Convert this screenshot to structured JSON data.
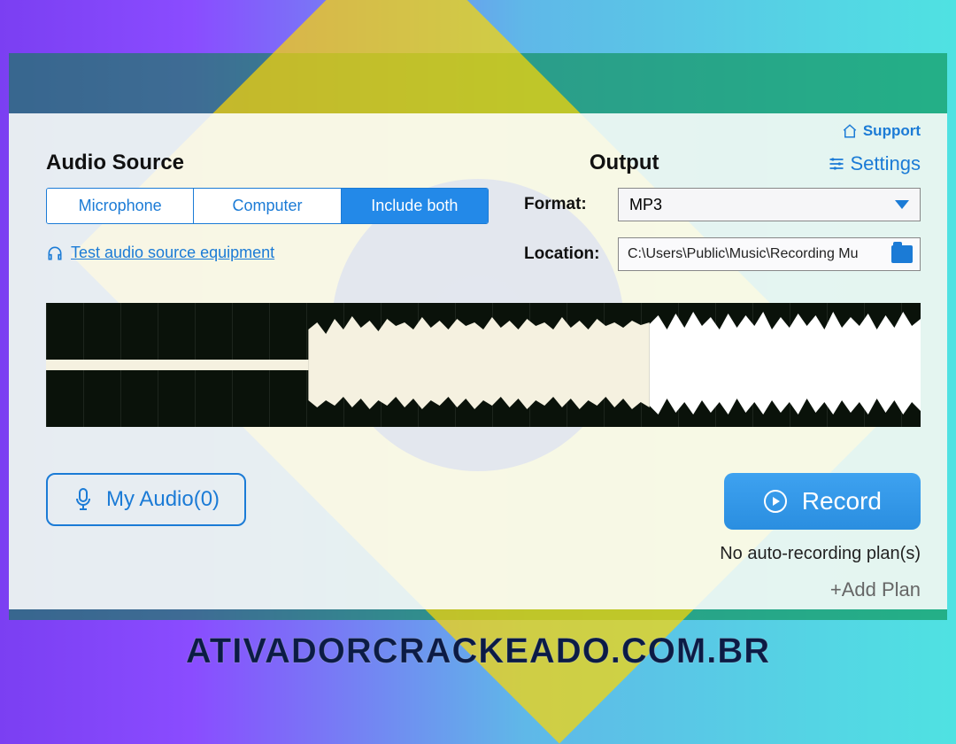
{
  "header": {
    "support_label": "Support"
  },
  "audio_source": {
    "title": "Audio Source",
    "tabs": [
      "Microphone",
      "Computer",
      "Include both"
    ],
    "active_index": 2,
    "test_link": "Test audio source equipment"
  },
  "output": {
    "title": "Output",
    "settings_label": "Settings",
    "format_label": "Format:",
    "format_value": "MP3",
    "location_label": "Location:",
    "location_value": "C:\\Users\\Public\\Music\\Recording Mu"
  },
  "bottom": {
    "my_audio_label": "My Audio(0)",
    "record_label": "Record",
    "plan_status": "No auto-recording plan(s)",
    "add_plan_label": "+Add Plan"
  },
  "watermark": "ATIVADORCRACKEADO.COM.BR",
  "colors": {
    "accent": "#1b7bd6",
    "record": "#2a8ee0"
  }
}
